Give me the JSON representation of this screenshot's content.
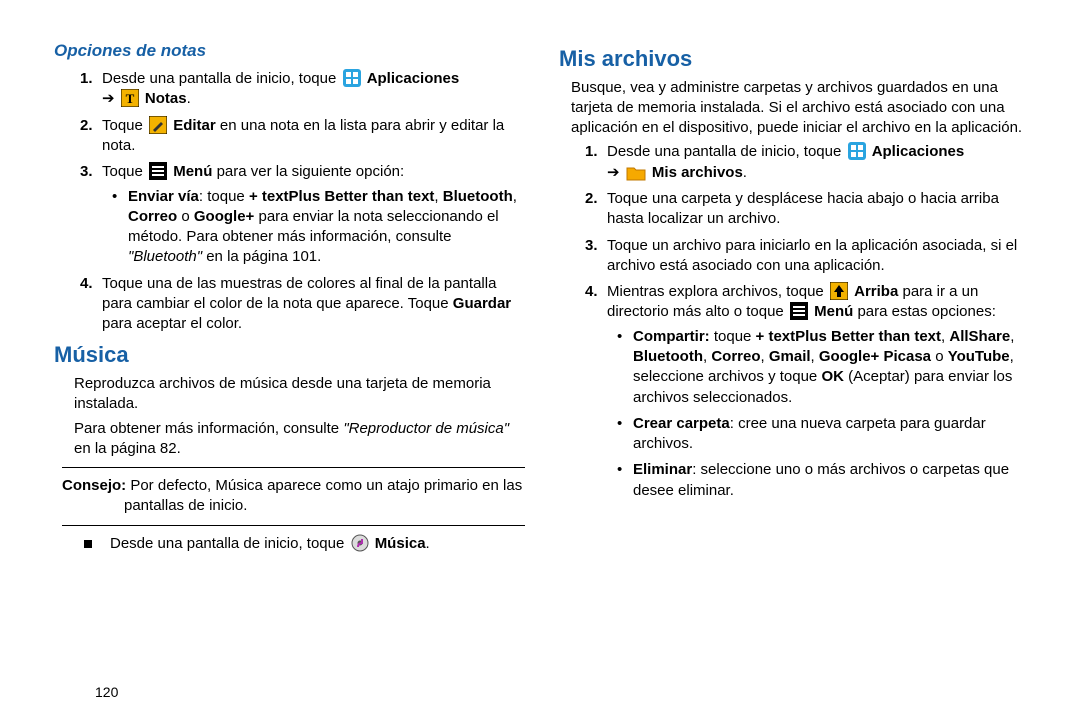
{
  "left": {
    "subheading": "Opciones de notas",
    "step1_a": "Desde una pantalla de inicio, toque ",
    "apps_label": "Aplicaciones",
    "arrow": "➔",
    "notas_label": "Notas",
    "step2_a": "Toque ",
    "editar_label": "Editar",
    "step2_b": " en una nota en la lista para abrir y editar la nota.",
    "step3_a": "Toque ",
    "menu_label": "Menú",
    "step3_b": " para ver la siguiente opción:",
    "enviar_via_label": "Enviar vía",
    "enviar_via_text_a": ": toque ",
    "enviar_via_apps": "+ textPlus Better than text",
    "comma": ", ",
    "bluetooth_bold": "Bluetooth",
    "correo_bold": "Correo",
    "or_word": " o ",
    "google_bold": "Google+",
    "enviar_via_text_b": " para enviar la nota seleccionando el método. Para obtener más información, consulte ",
    "bluetooth_ref": "\"Bluetooth\"",
    "enviar_via_page": " en la página 101.",
    "step4": "Toque una de las muestras de colores al final de la pantalla para cambiar el color de la nota que aparece. Toque ",
    "guardar_bold": "Guardar",
    "step4_b": " para aceptar el color.",
    "musica_title": "Música",
    "musica_p1": "Reproduzca archivos de música desde una tarjeta de memoria instalada.",
    "musica_p2a": "Para obtener más información, consulte ",
    "musica_ref": "\"Reproductor de música\"",
    "musica_p2b": " en la página 82.",
    "consejo_label": "Consejo:",
    "consejo_text": " Por defecto, Música aparece como un atajo primario en las pantallas de inicio.",
    "music_step_a": "Desde una pantalla de inicio, toque ",
    "music_label": "Música",
    "pagenum": "120"
  },
  "right": {
    "title": "Mis archivos",
    "intro": "Busque, vea y administre carpetas y archivos guardados en una tarjeta de memoria instalada. Si el archivo está asociado con una aplicación en el dispositivo, puede iniciar el archivo en la aplicación.",
    "step1_a": "Desde una pantalla de inicio, toque ",
    "apps_label": "Aplicaciones",
    "arrow": "➔",
    "misarch_label": "Mis archivos",
    "step2": "Toque una carpeta y desplácese hacia abajo o hacia arriba hasta localizar un archivo.",
    "step3": "Toque un archivo para iniciarlo en la aplicación asociada, si el archivo está asociado con una aplicación.",
    "step4_a": "Mientras explora archivos, toque ",
    "arriba_label": "Arriba",
    "step4_b": " para ir a un directorio más alto o toque ",
    "menu_label": "Menú",
    "step4_c": " para estas opciones:",
    "b1_label": "Compartir:",
    "b1_a": " toque ",
    "b1_apps": "+ textPlus Better than text",
    "allshare": "AllShare",
    "bluetooth": "Bluetooth",
    "correo": "Correo",
    "gmail": "Gmail",
    "gpicasa": "Google+ Picasa",
    "youtube": "YouTube",
    "b1_b": ", seleccione archivos y toque ",
    "ok_label": "OK",
    "b1_c": " (Aceptar) para enviar los archivos seleccionados.",
    "b2_label": "Crear carpeta",
    "b2_text": ": cree una nueva carpeta para guardar archivos.",
    "b3_label": "Eliminar",
    "b3_text": ": seleccione uno o más archivos o carpetas que desee eliminar."
  }
}
